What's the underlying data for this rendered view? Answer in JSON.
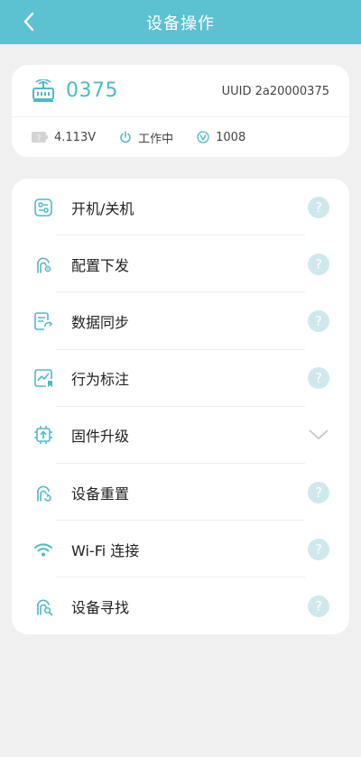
{
  "header": {
    "title": "设备操作",
    "background": "#5cc1d0"
  },
  "device": {
    "id": "0375",
    "uuid_label": "UUID 2a20000375",
    "voltage": "4.113V",
    "status": "工作中",
    "version": "1008",
    "accent": "#4fb8c9"
  },
  "menu": {
    "items": [
      {
        "label": "开机/关机",
        "icon": "power-toggle-icon",
        "trailing": "help"
      },
      {
        "label": "配置下发",
        "icon": "config-dispatch-icon",
        "trailing": "help"
      },
      {
        "label": "数据同步",
        "icon": "data-sync-icon",
        "trailing": "help"
      },
      {
        "label": "行为标注",
        "icon": "behavior-label-icon",
        "trailing": "help"
      },
      {
        "label": "固件升级",
        "icon": "firmware-chip-icon",
        "trailing": "chevron"
      },
      {
        "label": "设备重置",
        "icon": "device-reset-icon",
        "trailing": "help"
      },
      {
        "label": "Wi-Fi 连接",
        "icon": "wifi-icon",
        "trailing": "help"
      },
      {
        "label": "设备寻找",
        "icon": "device-find-icon",
        "trailing": "help"
      }
    ],
    "help_glyph": "?"
  }
}
